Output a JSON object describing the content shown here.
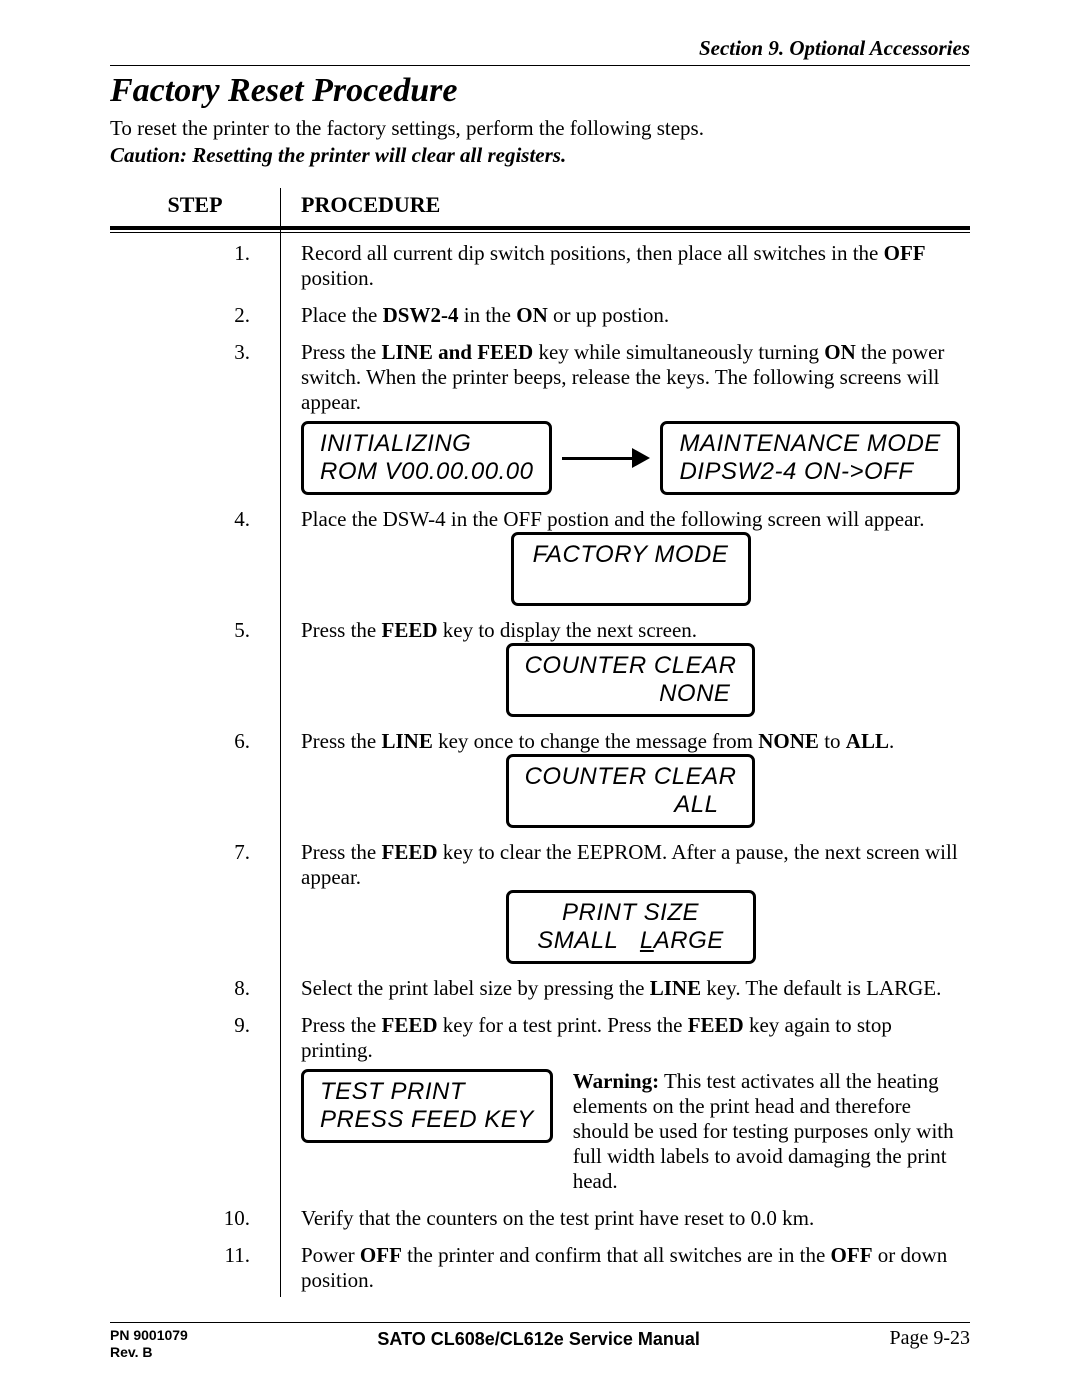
{
  "header": {
    "section": "Section 9.  Optional Accessories"
  },
  "title": "Factory Reset Procedure",
  "intro": "To reset the printer to the factory settings, perform the following steps.",
  "caution": "Caution:  Resetting the printer will clear all registers.",
  "table_headers": {
    "step": "STEP",
    "procedure": "PROCEDURE"
  },
  "steps": {
    "s1": {
      "n": "1.",
      "p1": "Record all current dip switch positions, then place all switches in the ",
      "b1": "OFF",
      "p2": " position."
    },
    "s2": {
      "n": "2.",
      "p1": "Place the ",
      "b1": "DSW2-4",
      "p2": " in the ",
      "b2": "ON",
      "p3": " or up postion."
    },
    "s3": {
      "n": "3.",
      "p1": "Press the ",
      "b1": "LINE and FEED",
      "p2": " key while simultaneously turning ",
      "b2": "ON",
      "p3": " the power switch.  When the printer beeps, release the keys.  The following screens will appear."
    },
    "s4": {
      "n": "4.",
      "p1": "Place the DSW-4 in the OFF postion and the following screen will appear."
    },
    "s5": {
      "n": "5.",
      "p1": "Press the ",
      "b1": "FEED",
      "p2": " key to display the next screen."
    },
    "s6": {
      "n": "6.",
      "p1": "Press the ",
      "b1": "LINE",
      "p2": " key once to change the message from ",
      "b2": "NONE",
      "p3": " to ",
      "b3": "ALL",
      "p4": "."
    },
    "s7": {
      "n": "7.",
      "p1": "Press the ",
      "b1": "FEED",
      "p2": " key to clear the EEPROM.  After a pause, the next screen will appear."
    },
    "s8": {
      "n": "8.",
      "p1": "Select the print label size by pressing the ",
      "b1": "LINE",
      "p2": " key.  The default is LARGE."
    },
    "s9": {
      "n": "9.",
      "p1": "Press the ",
      "b1": "FEED",
      "p2": " key for a test print.  Press the ",
      "b2": "FEED",
      "p3": " key again to stop printing."
    },
    "s10": {
      "n": "10.",
      "p1": "Verify that the counters on the test print have reset to 0.0 km."
    },
    "s11": {
      "n": "11.",
      "p1": "Power ",
      "b1": "OFF",
      "p2": " the printer and confirm that all switches are in the ",
      "b2": "OFF",
      "p3": " or down position."
    }
  },
  "lcd": {
    "init1": "INITIALIZING",
    "init2": "ROM V00.00.00.00",
    "maint1": "MAINTENANCE MODE",
    "maint2": "DIPSW2-4  ON->OFF",
    "factory": "FACTORY MODE",
    "cc1": "COUNTER CLEAR",
    "cc_none": "NONE",
    "cc_all": "ALL",
    "ps1": "PRINT SIZE",
    "ps_small": "SMALL",
    "ps_large_pre": "L",
    "ps_large_rest": "ARGE",
    "tp1": "TEST PRINT",
    "tp2": "PRESS FEED KEY"
  },
  "warning": {
    "label": "Warning:",
    "text": "  This test activates all the heating elements on the print head and therefore should be used for testing purposes only with full width labels to avoid damaging the print head."
  },
  "footer": {
    "pn": "PN 9001079",
    "rev": "Rev. B",
    "manual": "SATO CL608e/CL612e Service Manual",
    "page": "Page 9-23"
  }
}
